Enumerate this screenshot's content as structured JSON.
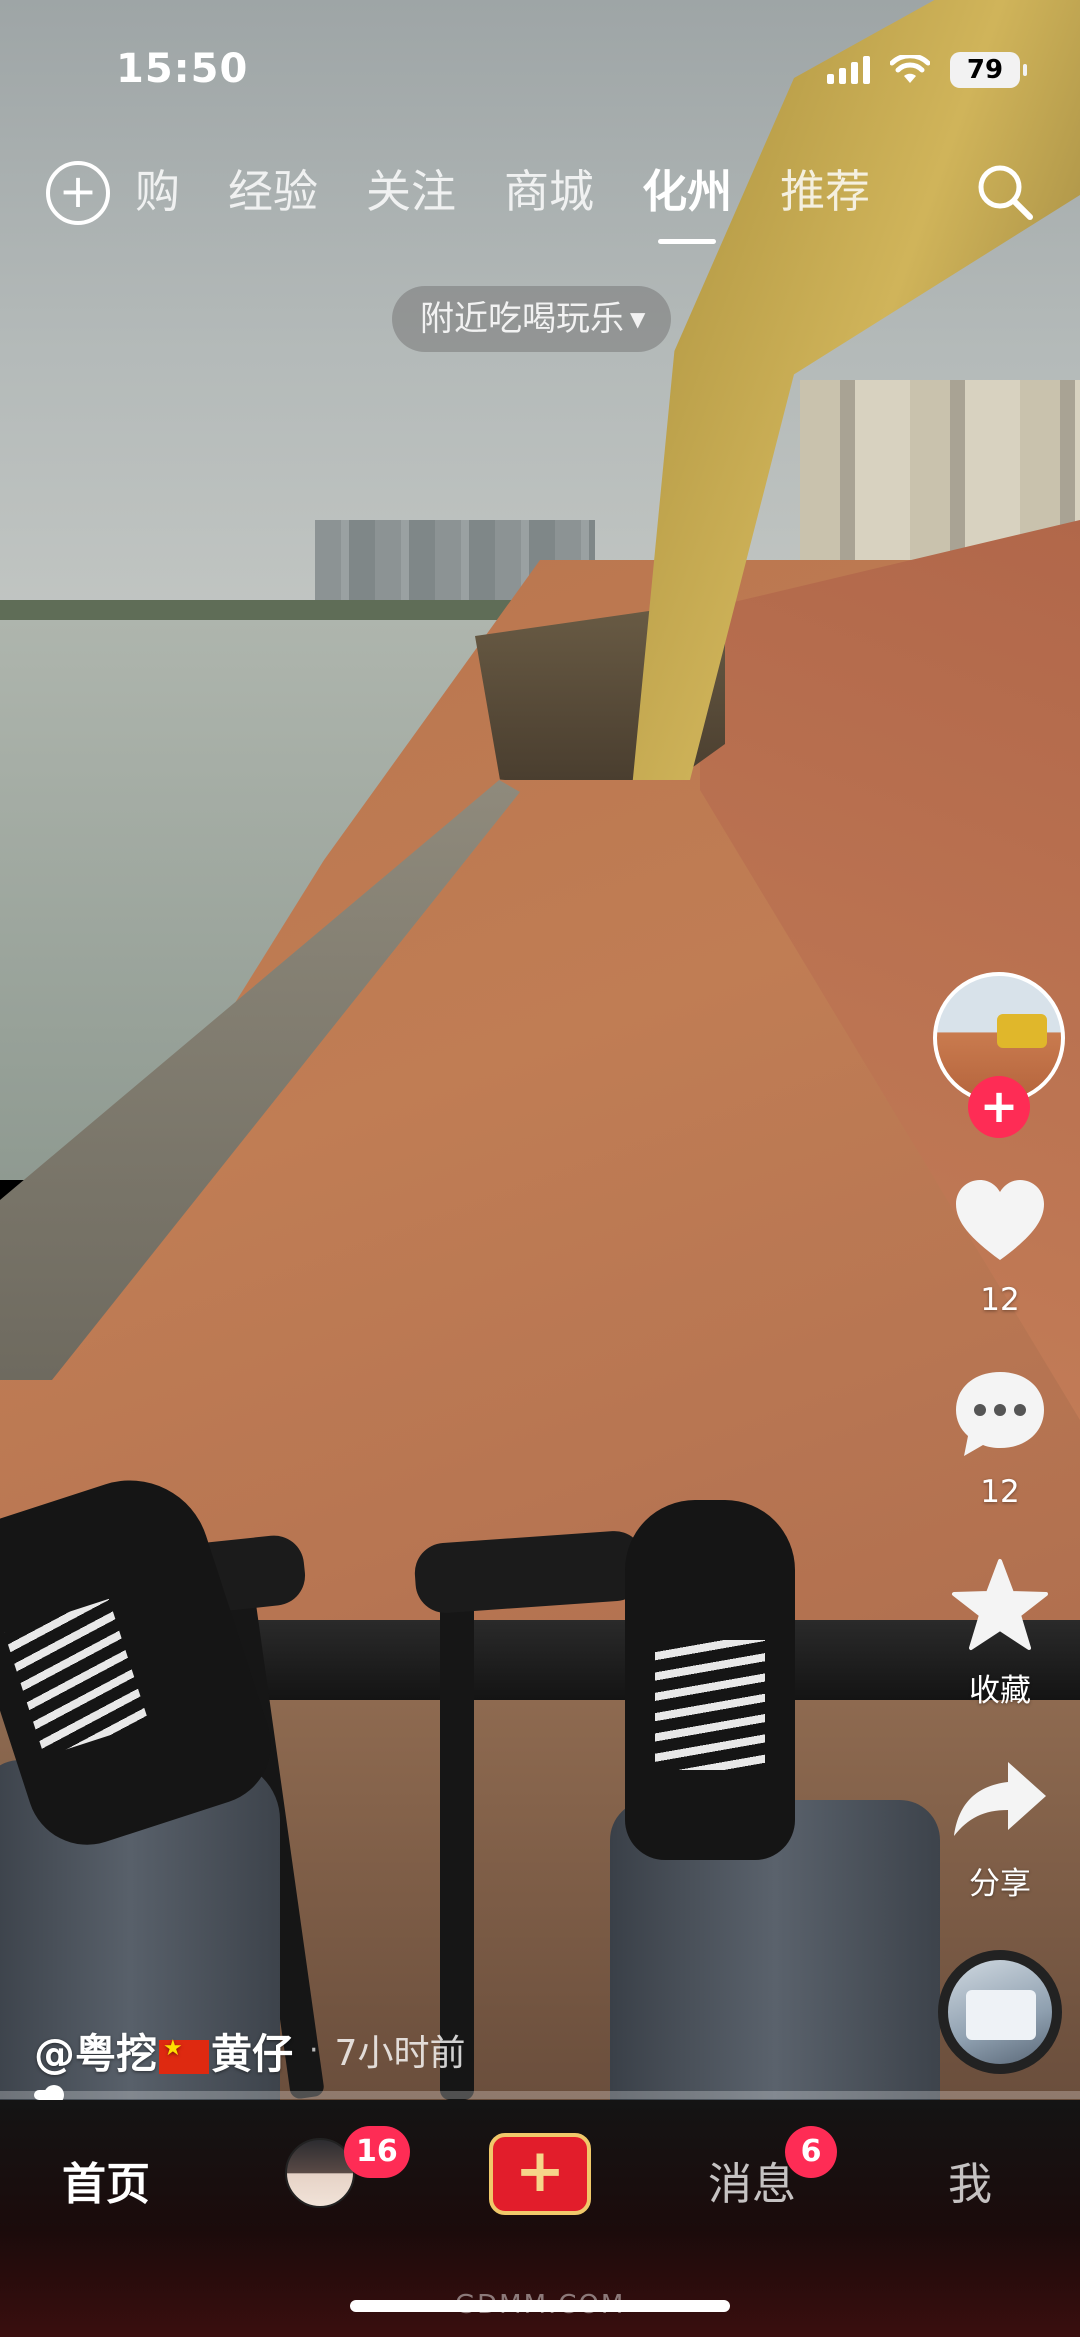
{
  "status_bar": {
    "time": "15:50",
    "battery": "79"
  },
  "top_nav": {
    "tabs": [
      {
        "label": "团购",
        "partial": "购"
      },
      {
        "label": "经验"
      },
      {
        "label": "关注"
      },
      {
        "label": "商城"
      },
      {
        "label": "化州",
        "active": true
      },
      {
        "label": "推荐"
      }
    ],
    "plus_icon": "circle-plus-icon",
    "search_icon": "search-icon"
  },
  "nearby_pill": {
    "label": "附近吃喝玩乐"
  },
  "actions": {
    "like_count": "12",
    "comment_count": "12",
    "favorite_label": "收藏",
    "share_label": "分享"
  },
  "caption": {
    "author_prefix": "@粤挖",
    "author_suffix": "黄仔",
    "separator": "·",
    "time": "7小时前"
  },
  "progress": {
    "fraction": 0.01
  },
  "bottom_nav": {
    "home": "首页",
    "friends_badge": "16",
    "post_icon": "+",
    "messages": "消息",
    "messages_badge": "6",
    "me": "我"
  },
  "watermark": "GDMM.COM",
  "colors": {
    "accent": "#fe2c55",
    "post_button": "#e21d2b",
    "post_border": "#f0c86a"
  }
}
